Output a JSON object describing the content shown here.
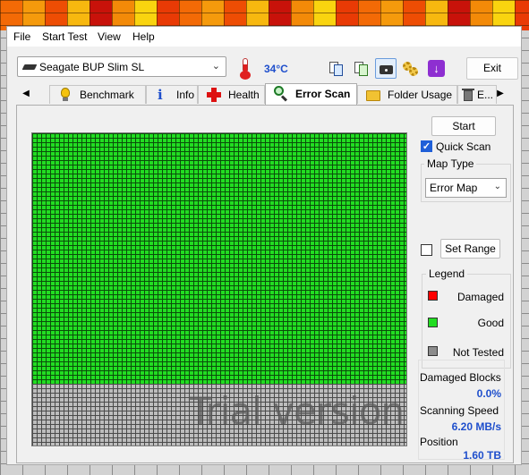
{
  "menu": [
    "File",
    "Start Test",
    "View",
    "Help"
  ],
  "toolbar": {
    "drive": "Seagate BUP Slim SL",
    "temperature": "34°C",
    "exit_label": "Exit",
    "tool_icons": [
      "copy-report-icon",
      "copy-green-icon",
      "screenshot-icon",
      "settings-gears-icon",
      "download-icon"
    ]
  },
  "tabs": [
    {
      "label": "Benchmark",
      "icon": "benchmark-icon"
    },
    {
      "label": "Info",
      "icon": "info-icon"
    },
    {
      "label": "Health",
      "icon": "health-icon"
    },
    {
      "label": "Error Scan",
      "icon": "error-scan-icon",
      "active": true
    },
    {
      "label": "Folder Usage",
      "icon": "folder-icon"
    },
    {
      "label": "E...",
      "icon": "erase-icon"
    }
  ],
  "scan": {
    "start_label": "Start",
    "quick_scan_label": "Quick Scan",
    "quick_scan_checked": true,
    "map_type_title": "Map Type",
    "map_type_value": "Error Map",
    "set_range_checked": false,
    "set_range_label": "Set Range",
    "watermark": "Trial version",
    "scanned_fraction": 0.8
  },
  "legend": {
    "title": "Legend",
    "items": [
      {
        "label": "Damaged",
        "color": "#ff0000"
      },
      {
        "label": "Good",
        "color": "#22dd22"
      },
      {
        "label": "Not Tested",
        "color": "#8c8c8c"
      }
    ]
  },
  "stats": [
    {
      "label": "Damaged Blocks",
      "value": "0.0%"
    },
    {
      "label": "Scanning Speed",
      "value": "6.20 MB/s"
    },
    {
      "label": "Position",
      "value": "1.60 TB"
    }
  ],
  "colors": {
    "value_blue": "#1f4fcc",
    "good": "#22dd22",
    "untested": "#bdbdbd"
  }
}
